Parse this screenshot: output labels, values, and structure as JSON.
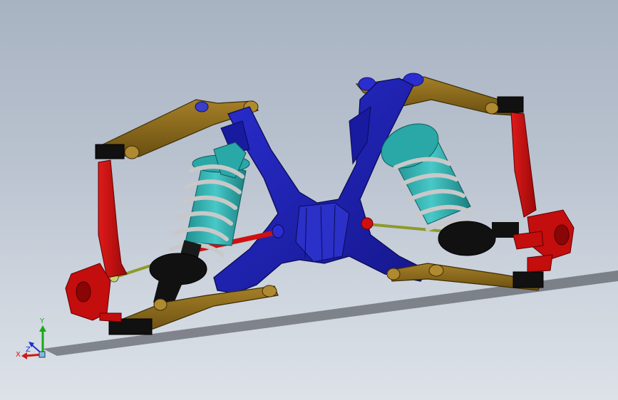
{
  "viewport": {
    "background_top": "#a8b3c2",
    "background_bottom": "#dde2e8"
  },
  "triad": {
    "x_label": "X",
    "y_label": "Y",
    "z_label": "Z",
    "x_color": "#d01818",
    "y_color": "#1aa81a",
    "z_color": "#1c2fd0"
  },
  "model_colors": {
    "subframe": "#1d1fae",
    "control_arm": "#8a6a18",
    "upright": "#c40d0d",
    "coilover_body": "#2aa7a7",
    "spring": "#c8c8c8",
    "bushing": "#111111",
    "tie_rod": "#8d9a2a",
    "anti_roll_link": "#d01010"
  }
}
